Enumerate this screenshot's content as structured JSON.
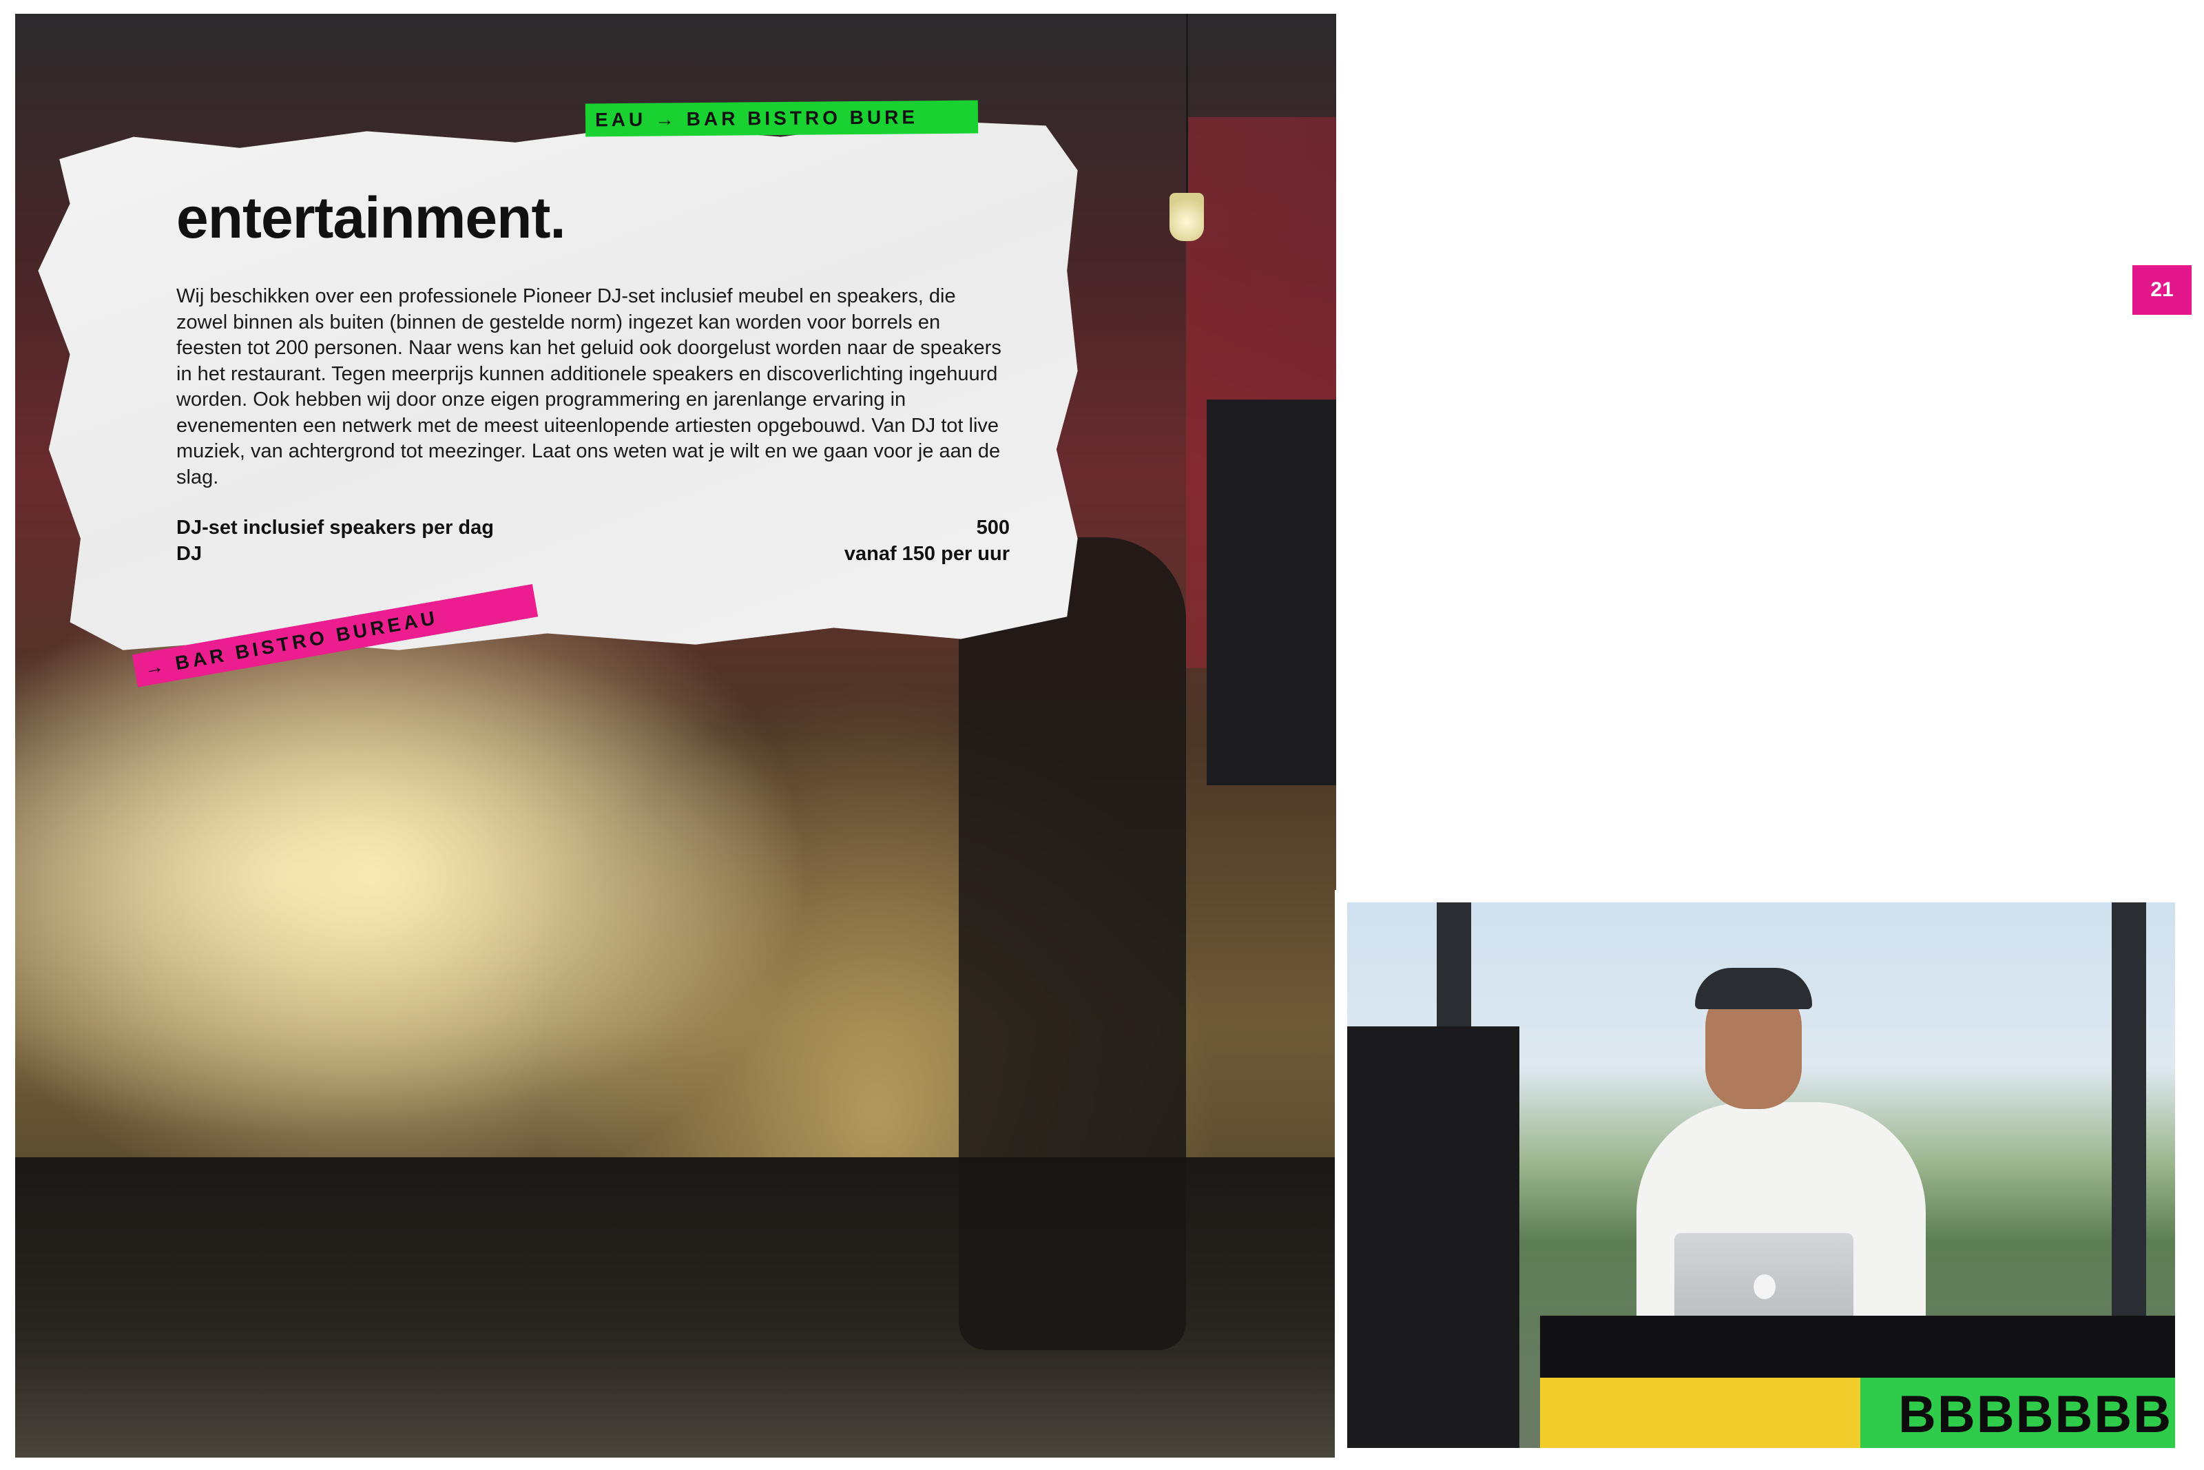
{
  "page": {
    "number": "21",
    "accent_color": "#e4168c"
  },
  "section": {
    "title": "entertainment.",
    "body": "Wij beschikken over een professionele Pioneer DJ-set inclusief meubel en speakers, die zowel binnen als buiten (binnen de gestelde norm) ingezet kan worden voor borrels en feesten tot 200 personen. Naar wens kan het geluid ook doorgelust worden naar de speakers in het restaurant. Tegen meerprijs kunnen additionele speakers en discoverlichting ingehuurd worden. Ook hebben wij door onze eigen programmering en jarenlange ervaring in evenementen een netwerk met de meest uiteenlopende artiesten opgebouwd. Van DJ tot live muziek, van achtergrond tot meezinger. Laat ons weten wat je wilt en we gaan voor je aan de slag."
  },
  "prices": [
    {
      "label": "DJ-set inclusief speakers per dag",
      "value": "500"
    },
    {
      "label": "DJ",
      "value": "vanaf 150 per uur"
    }
  ],
  "tapes": {
    "top": "EAU → BAR BISTRO BURE",
    "top_color": "#19d231",
    "bottom": "→ BAR BISTRO BUREAU",
    "bottom_color": "#ec1d8f"
  },
  "inset": {
    "banner_text": "BBBBBBB"
  }
}
